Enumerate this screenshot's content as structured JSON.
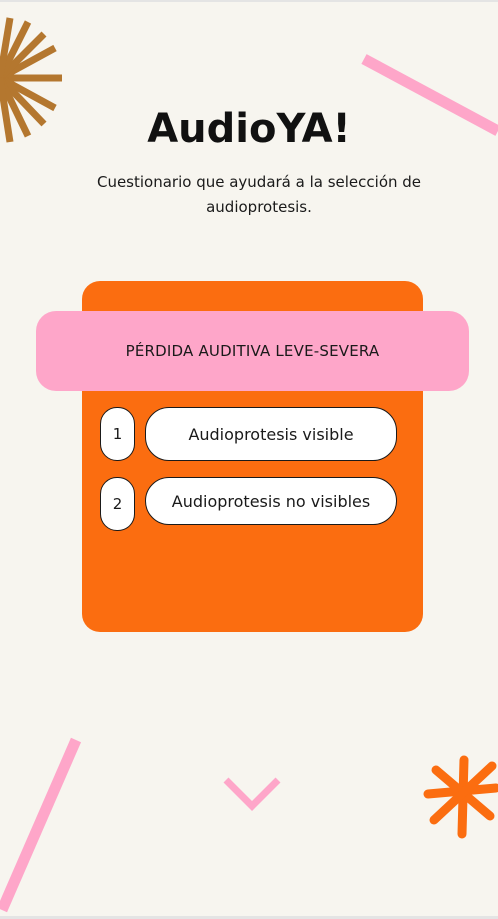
{
  "app": {
    "title": "AudioYA!",
    "subtitle": "Cuestionario que ayudará a la selección de audioprotesis."
  },
  "question": {
    "banner": "PÉRDIDA AUDITIVA LEVE-SEVERA",
    "options": [
      {
        "number": "1",
        "label": "Audioprotesis visible"
      },
      {
        "number": "2",
        "label": "Audioprotesis no visibles"
      }
    ]
  },
  "colors": {
    "background": "#f7f5ef",
    "card": "#fb6d10",
    "banner": "#fea6c9",
    "sunburst": "#b4772f",
    "pink_accent": "#fea6c9",
    "orange_accent": "#fb6d10"
  },
  "icons": {
    "top_left": "sunburst-icon",
    "bottom_center": "chevron-down-icon",
    "bottom_right": "asterisk-icon"
  }
}
